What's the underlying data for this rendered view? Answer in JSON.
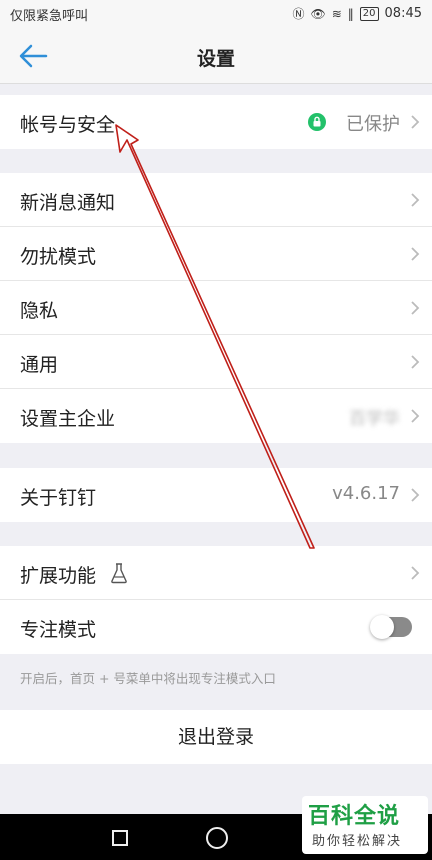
{
  "status_bar": {
    "carrier": "仅限紧急呼叫",
    "battery": "20",
    "time": "08:45"
  },
  "header": {
    "title": "设置"
  },
  "sections": {
    "account": {
      "label": "帐号与安全",
      "value": "已保护"
    },
    "general": {
      "new_msg": "新消息通知",
      "dnd": "勿扰模式",
      "privacy": "隐私",
      "common": "通用",
      "main_company": "设置主企业",
      "main_company_value": "百学华"
    },
    "about": {
      "label": "关于钉钉",
      "version": "v4.6.17"
    },
    "extensions": {
      "label": "扩展功能"
    },
    "focus": {
      "label": "专注模式",
      "enabled": false
    }
  },
  "hint": "开启后，首页 + 号菜单中将出现专注模式入口",
  "logout": "退出登录",
  "watermark": {
    "title": "百科全说",
    "subtitle": "助你轻松解决"
  },
  "colors": {
    "accent": "#2f8fd8",
    "lock_green": "#23c16a",
    "arrow_red": "#c0201a"
  }
}
